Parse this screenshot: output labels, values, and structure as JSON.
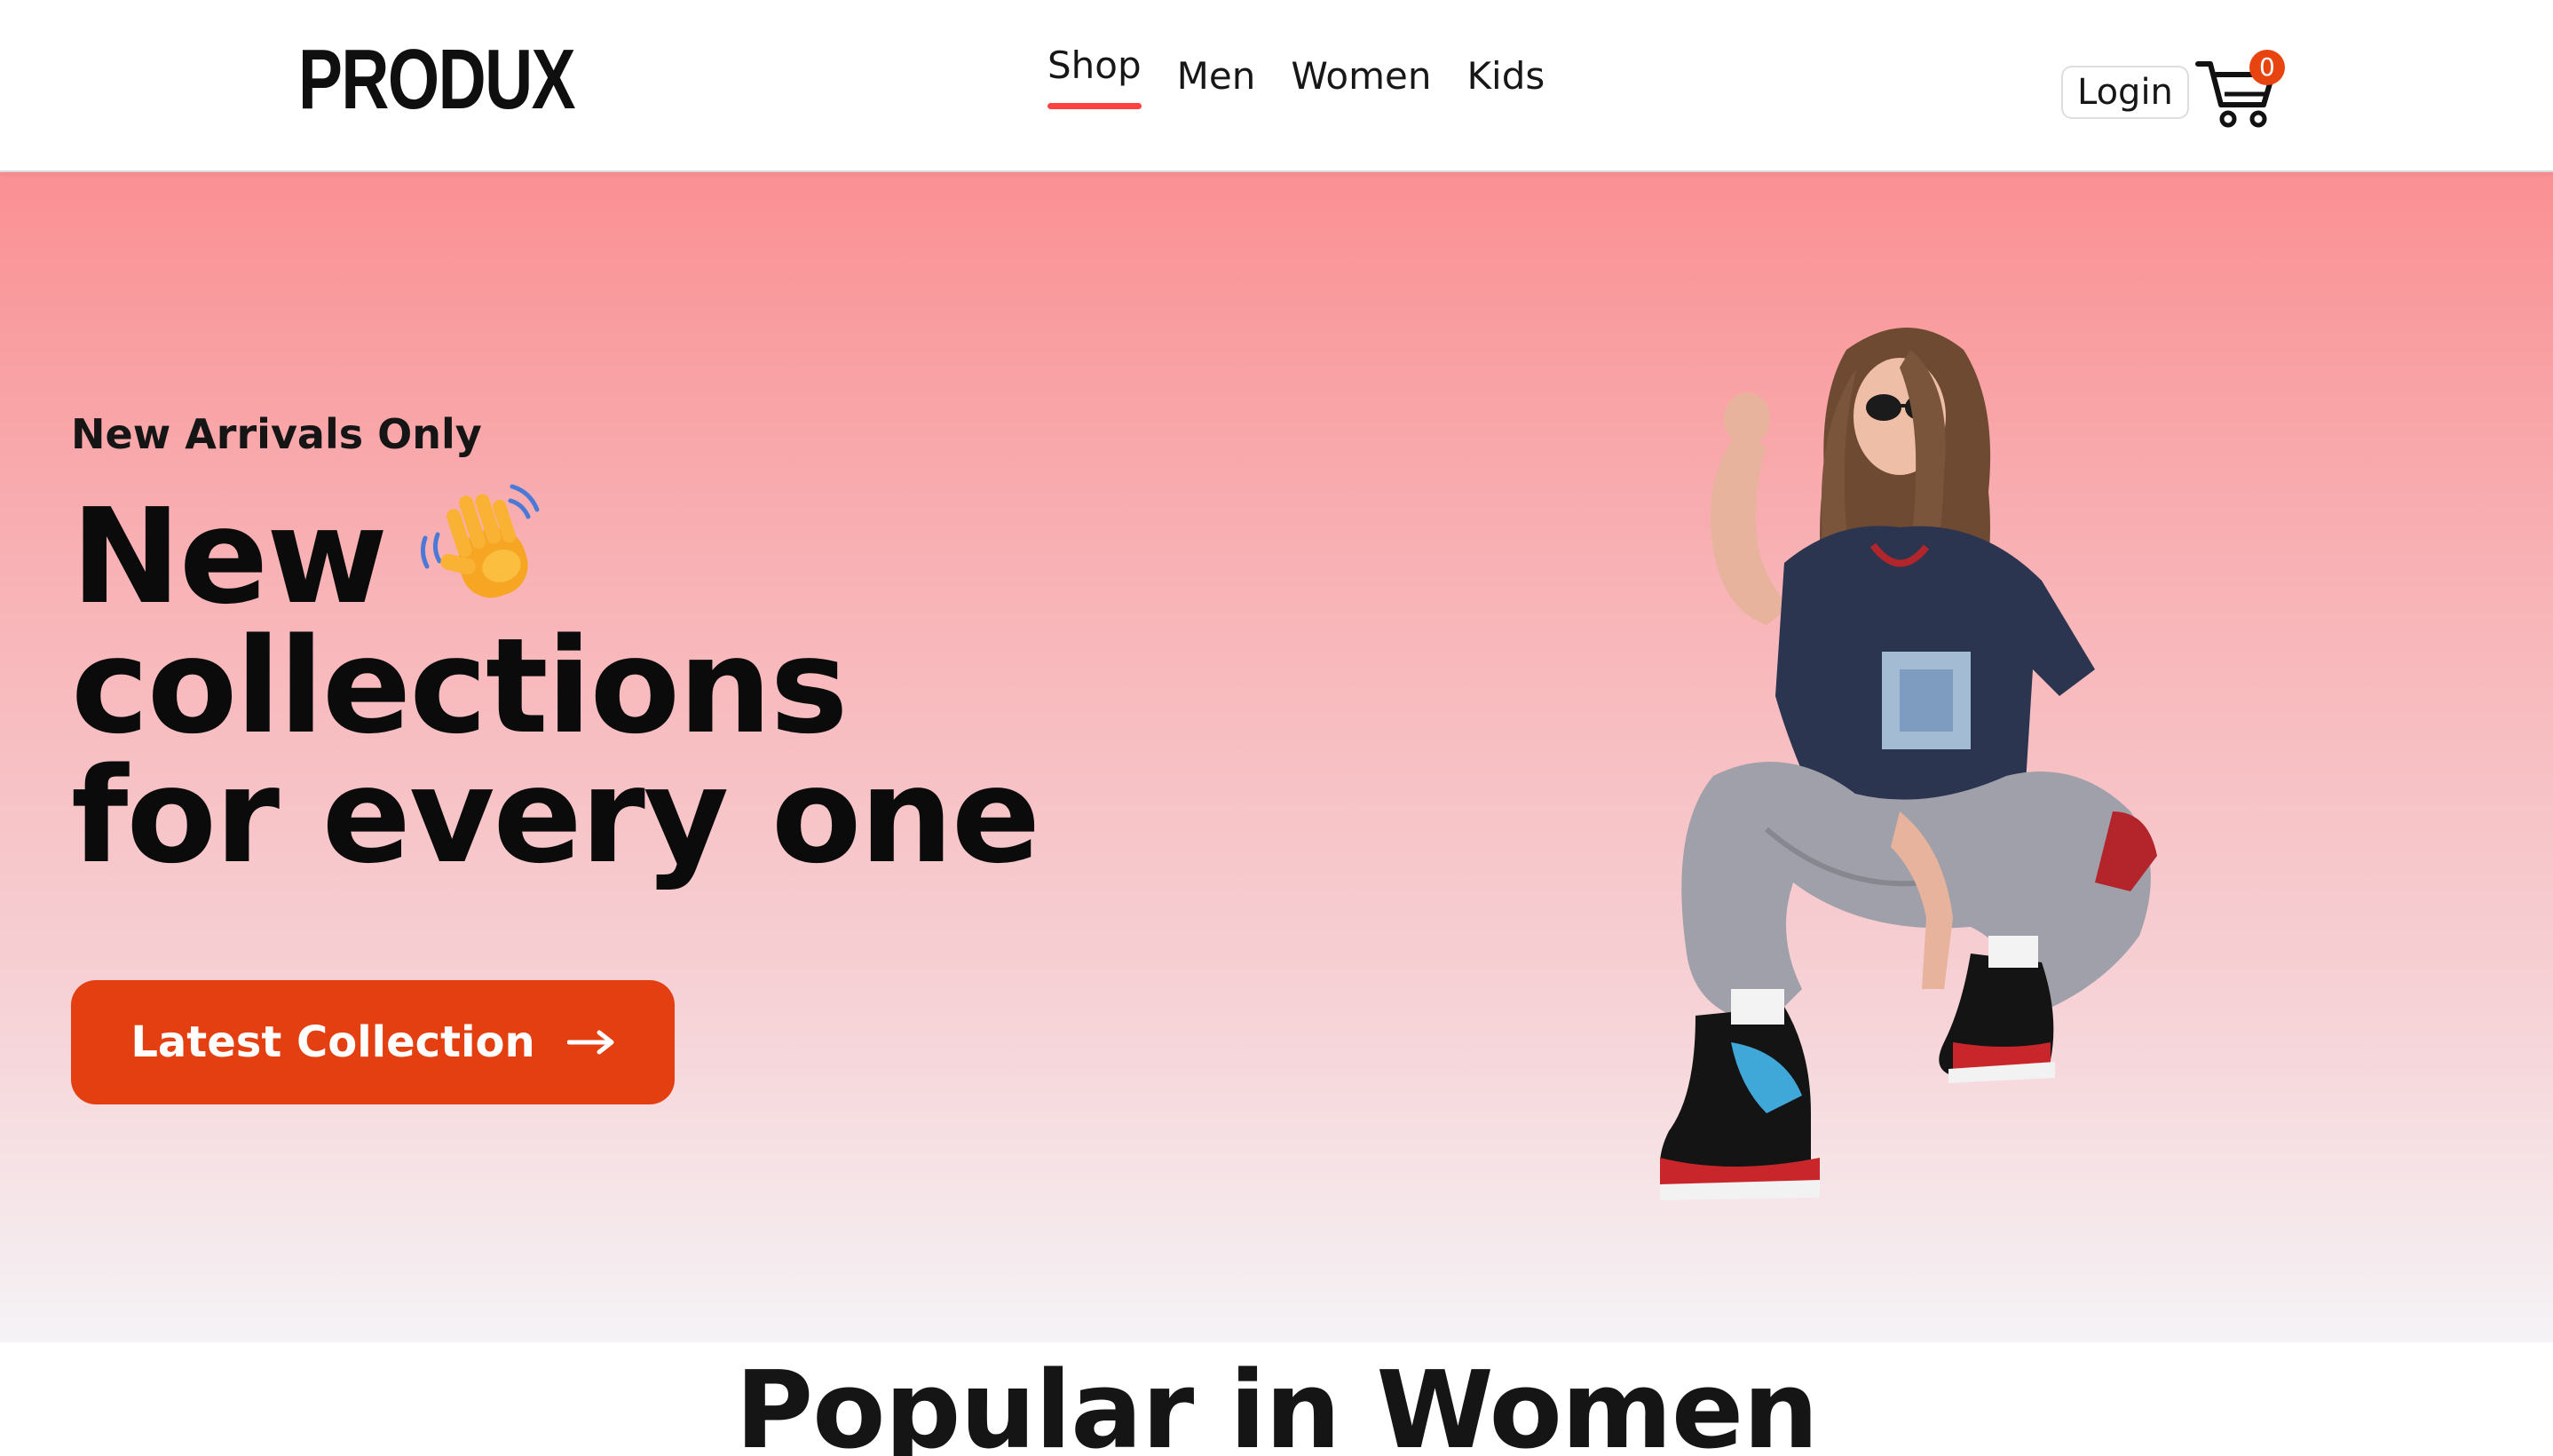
{
  "brand": {
    "logo_text": "PRODUX"
  },
  "nav": {
    "items": [
      {
        "label": "Shop",
        "active": true
      },
      {
        "label": "Men",
        "active": false
      },
      {
        "label": "Women",
        "active": false
      },
      {
        "label": "Kids",
        "active": false
      }
    ],
    "login_label": "Login",
    "cart_count": "0",
    "accent_color": "#ff4141"
  },
  "hero": {
    "eyebrow": "New Arrivals Only",
    "headline_lines": [
      "New",
      "collections",
      "for every one"
    ],
    "headline_icon": "waving-hand-icon",
    "cta_label": "Latest Collection",
    "cta_icon": "arrow-right-icon",
    "cta_color": "#e43f11",
    "gradient_top": "#fa9093",
    "gradient_bottom": "#f5f3f6"
  },
  "popular": {
    "title": "Popular in Women"
  }
}
